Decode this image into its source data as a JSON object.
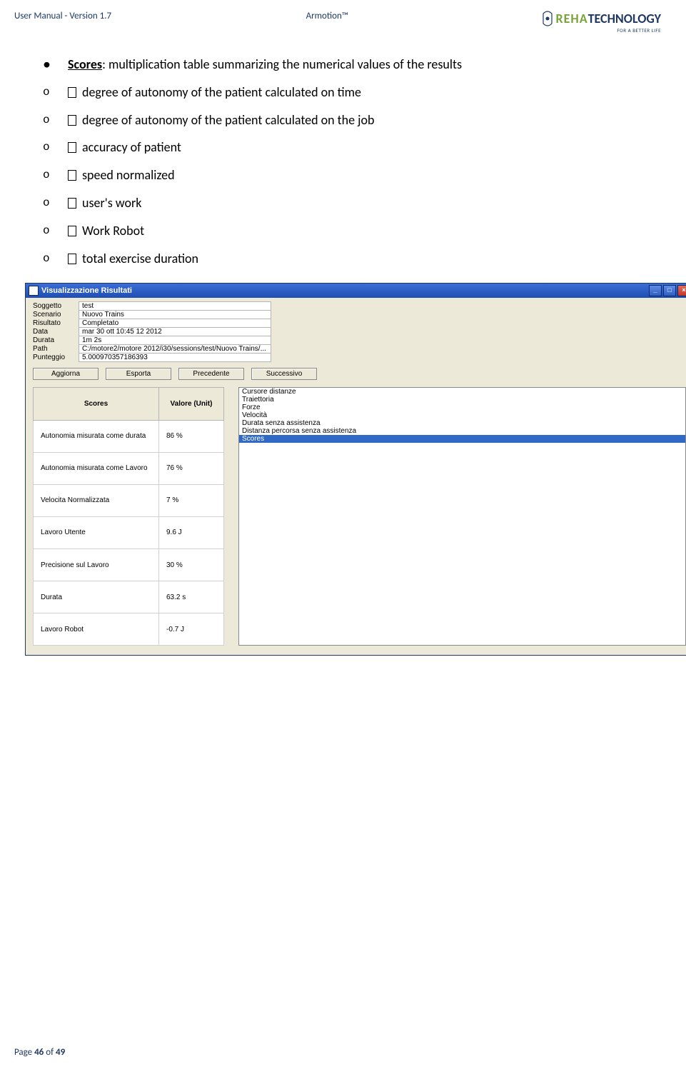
{
  "header": {
    "left": "User Manual - Version 1.7",
    "center": "Armotion™",
    "logo": {
      "reha": "REHA",
      "tech": "TECHNOLOGY",
      "tag": "FOR A BETTER LIFE"
    }
  },
  "bullets": {
    "main_prefix": "Scores",
    "main_rest": ": multiplication table summarizing the numerical values of the results",
    "subs": [
      "degree of autonomy of the patient calculated on time",
      "degree of autonomy of the patient calculated on the job",
      "accuracy of patient",
      "speed normalized",
      "user's work",
      "Work Robot",
      "total exercise duration"
    ]
  },
  "win": {
    "title": "Visualizzazione Risultati",
    "btn_min": "_",
    "btn_max": "□",
    "btn_close": "×",
    "info": [
      {
        "lbl": "Soggetto",
        "val": "test"
      },
      {
        "lbl": "Scenario",
        "val": "Nuovo Trains"
      },
      {
        "lbl": "Risultato",
        "val": "Completato"
      },
      {
        "lbl": "Data",
        "val": "mar 30 ott 10:45 12 2012"
      },
      {
        "lbl": "Durata",
        "val": "1m 2s"
      },
      {
        "lbl": "Path",
        "val": "C:/motore2/motore 2012/i30/sessions/test/Nuovo Trains/..."
      },
      {
        "lbl": "Punteggio",
        "val": "5.000970357186393"
      }
    ],
    "buttons": [
      "Aggiorna",
      "Esporta",
      "Precedente",
      "Successivo"
    ],
    "score_hdr": [
      "Scores",
      "Valore (Unit)"
    ],
    "scores": [
      {
        "name": "Autonomia misurata come durata",
        "val": "86 %"
      },
      {
        "name": "Autonomia misurata come Lavoro",
        "val": "76 %"
      },
      {
        "name": "Velocita Normalizzata",
        "val": "7 %"
      },
      {
        "name": "Lavoro Utente",
        "val": "9.6 J"
      },
      {
        "name": "Precisione sul Lavoro",
        "val": "30 %"
      },
      {
        "name": "Durata",
        "val": "63.2 s"
      },
      {
        "name": "Lavoro Robot",
        "val": "-0.7 J"
      }
    ],
    "list": [
      "Cursore distanze",
      "Traiettoria",
      "Forze",
      "Velocità",
      "Durata senza assistenza",
      "Distanza percorsa senza assistenza",
      "Scores"
    ],
    "selected_index": 6
  },
  "footer": {
    "pre": "Page ",
    "cur": "46",
    "mid": " of ",
    "tot": "49"
  }
}
